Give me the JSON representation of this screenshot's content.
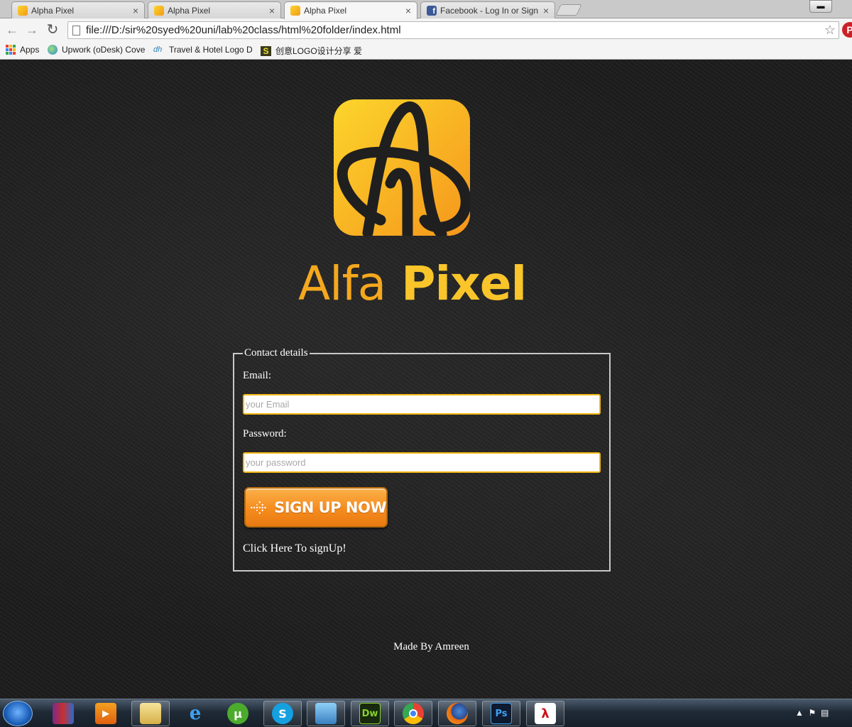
{
  "browser": {
    "tabs": [
      {
        "title": "Alpha Pixel",
        "favicon": "alpha-pixel-favicon",
        "active": false
      },
      {
        "title": "Alpha Pixel",
        "favicon": "alpha-pixel-favicon",
        "active": false
      },
      {
        "title": "Alpha Pixel",
        "favicon": "alpha-pixel-favicon",
        "active": true
      },
      {
        "title": "Facebook - Log In or Sign",
        "favicon": "facebook-favicon",
        "active": false
      }
    ],
    "close_glyph": "×",
    "address": "file:///D:/sir%20syed%20uni/lab%20class/html%20folder/index.html",
    "bookmarks": [
      {
        "label": "Apps",
        "icon": "apps-grid-icon"
      },
      {
        "label": "Upwork (oDesk) Cove",
        "icon": "upwork-icon"
      },
      {
        "label": "Travel & Hotel Logo D",
        "icon": "dh-icon"
      },
      {
        "label": "创意LOGO设计分享 爱",
        "icon": "s-icon"
      }
    ]
  },
  "page": {
    "logo_text": "Alfa Pixel",
    "logo_word1": "Alfa",
    "logo_word2": "Pixel",
    "form": {
      "legend": "Contact details",
      "email_label": "Email:",
      "email_placeholder": "your Email",
      "email_value": "",
      "password_label": "Password:",
      "password_placeholder": "your password",
      "password_value": "",
      "signup_button_label": "SIGN UP NOW",
      "signup_link": "Click Here To signUp!"
    },
    "footer": "Made By Amreen"
  },
  "colors": {
    "brand_orange": "#f5a81e",
    "brand_yellow": "#f9c52a",
    "input_border": "#f5b916",
    "button_orange": "#f58c1e"
  },
  "taskbar": {
    "items": [
      "start-orb",
      "winrar",
      "media-player",
      "file-explorer",
      "internet-explorer",
      "utorrent",
      "skype",
      "photo-viewer",
      "dreamweaver",
      "chrome",
      "firefox",
      "photoshop",
      "acrobat"
    ],
    "dreamweaver_label": "Dw",
    "photoshop_label": "Ps"
  }
}
